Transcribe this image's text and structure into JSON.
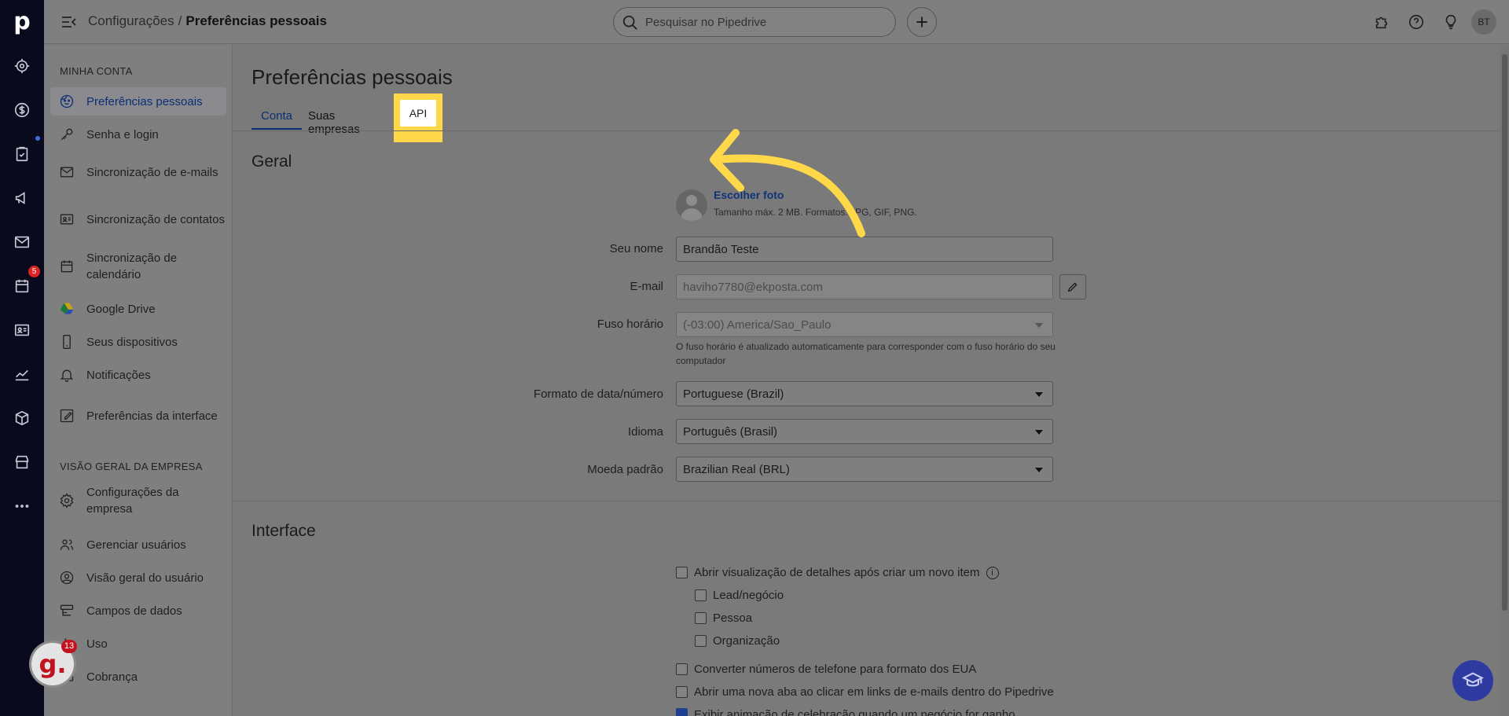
{
  "rail": {
    "logo": "p",
    "calendar_badge": "5"
  },
  "topbar": {
    "breadcrumb_parent": "Configurações",
    "breadcrumb_sep": "/",
    "breadcrumb_current": "Preferências pessoais",
    "search_placeholder": "Pesquisar no Pipedrive",
    "avatar_initials": "BT"
  },
  "sidebar": {
    "section1_title": "MINHA CONTA",
    "section2_title": "VISÃO GERAL DA EMPRESA",
    "items1": [
      {
        "label": "Preferências pessoais",
        "icon": "face-icon"
      },
      {
        "label": "Senha e login",
        "icon": "key-icon"
      },
      {
        "label": "Sincronização de e-mails",
        "icon": "mail-icon"
      },
      {
        "label": "Sincronização de contatos",
        "icon": "contact-card-icon"
      },
      {
        "label": "Sincronização de calendário",
        "icon": "calendar-icon"
      },
      {
        "label": "Google Drive",
        "icon": "google-drive-icon"
      },
      {
        "label": "Seus dispositivos",
        "icon": "phone-icon"
      },
      {
        "label": "Notificações",
        "icon": "bell-icon"
      },
      {
        "label": "Preferências da interface",
        "icon": "interface-edit-icon"
      }
    ],
    "items2": [
      {
        "label": "Configurações da empresa",
        "icon": "gear-icon"
      },
      {
        "label": "Gerenciar usuários",
        "icon": "users-icon"
      },
      {
        "label": "Visão geral do usuário",
        "icon": "user-circle-icon"
      },
      {
        "label": "Campos de dados",
        "icon": "data-fields-icon"
      },
      {
        "label": "Uso",
        "icon": "usage-icon"
      },
      {
        "label": "Cobrança",
        "icon": "billing-icon"
      }
    ]
  },
  "main": {
    "title": "Preferências pessoais",
    "tabs": [
      "Conta",
      "Suas empresas",
      "API"
    ],
    "general_heading": "Geral",
    "photo_link": "Escolher foto",
    "photo_hint": "Tamanho máx. 2 MB. Formatos: JPG, GIF, PNG.",
    "name_label": "Seu nome",
    "name_value": "Brandão Teste",
    "email_label": "E-mail",
    "email_value": "haviho7780@ekposta.com",
    "tz_label": "Fuso horário",
    "tz_value": "(-03:00) America/Sao_Paulo",
    "tz_note": "O fuso horário é atualizado automaticamente para corresponder com o fuso horário do seu computador",
    "date_label": "Formato de data/número",
    "date_value": "Portuguese (Brazil)",
    "lang_label": "Idioma",
    "lang_value": "Português (Brasil)",
    "currency_label": "Moeda padrão",
    "currency_value": "Brazilian Real (BRL)",
    "interface_heading": "Interface",
    "cb_open_details": "Abrir visualização de detalhes após criar um novo item",
    "cb_lead": "Lead/negócio",
    "cb_person": "Pessoa",
    "cb_org": "Organização",
    "cb_phone": "Converter números de telefone para formato dos EUA",
    "cb_newtab": "Abrir uma nova aba ao clicar em links de e-mails dentro do Pipedrive",
    "cb_celebrate": "Exibir animação de celebração quando um negócio for ganho"
  },
  "widget": {
    "letter": "g.",
    "badge": "13"
  },
  "colors": {
    "accent": "#0c2e75",
    "highlight": "#ffd84a",
    "rail": "#0a0a1f"
  }
}
